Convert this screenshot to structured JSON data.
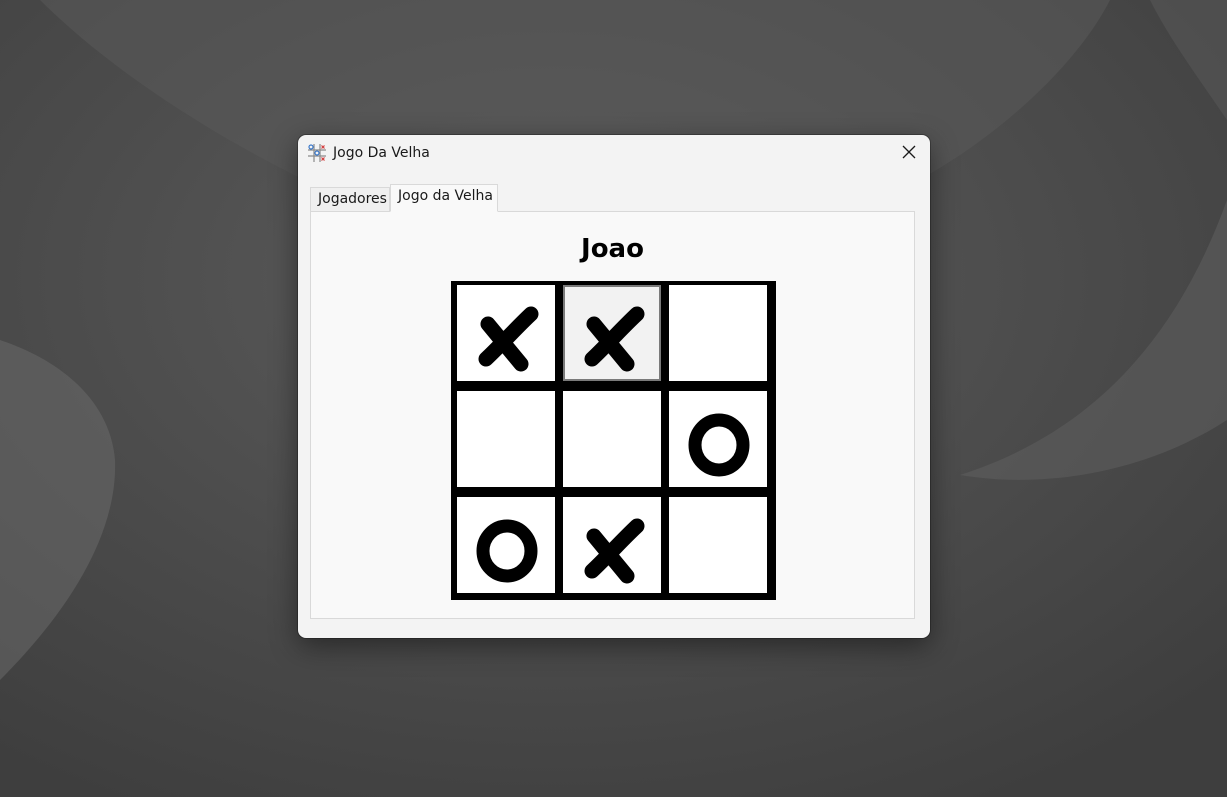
{
  "window": {
    "title": "Jogo Da Velha",
    "icon": "tic-tac-toe-app-icon",
    "close_icon": "close-icon"
  },
  "tabs": [
    {
      "label": "Jogadores",
      "selected": false
    },
    {
      "label": "Jogo da Velha",
      "selected": true
    }
  ],
  "game": {
    "current_player": "Joao",
    "board": [
      [
        "X",
        "X",
        ""
      ],
      [
        "",
        "",
        "O"
      ],
      [
        "O",
        "X",
        ""
      ]
    ],
    "hovered_cell": [
      0,
      1
    ]
  },
  "colors": {
    "board_lines": "#000000",
    "cell_background": "#ffffff",
    "mark_color": "#000000",
    "window_background": "#f3f3f3"
  }
}
